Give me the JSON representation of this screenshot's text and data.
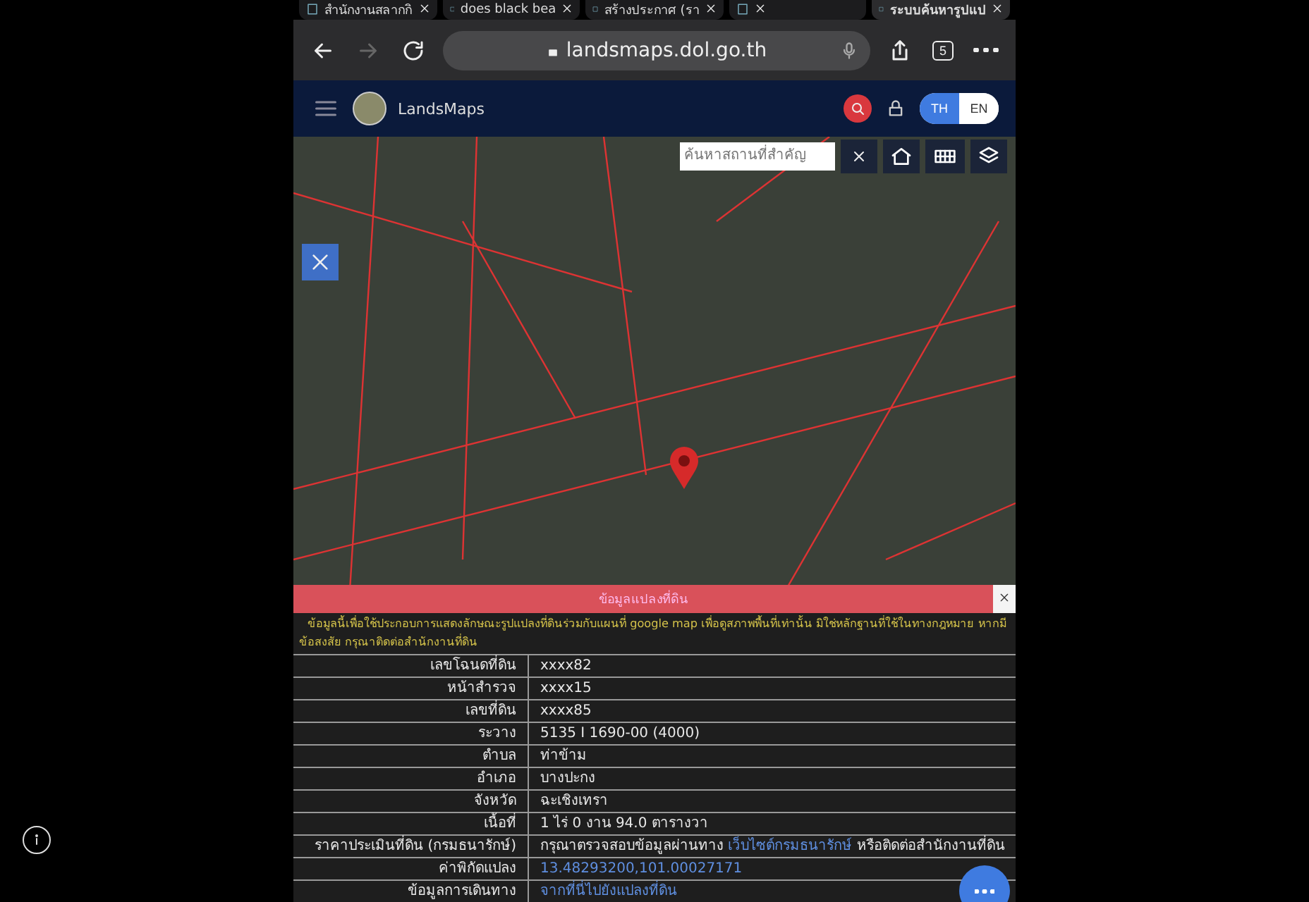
{
  "browser": {
    "tabs": [
      {
        "title": "สำนักงานสลากกิ",
        "selected": false
      },
      {
        "title": "does black bea",
        "selected": false
      },
      {
        "title": "สร้างประกาศ (รา",
        "selected": false
      },
      {
        "selected": false
      },
      {
        "title": "ระบบค้นหารูปแป",
        "selected": true
      }
    ],
    "url": "landsmaps.dol.go.th",
    "forward_disabled": true,
    "tab_count": "5"
  },
  "app": {
    "name": "LandsMaps",
    "languages": [
      {
        "label": "TH",
        "selected": true
      },
      {
        "label": "EN",
        "selected": false
      }
    ]
  },
  "map": {
    "search": {
      "placeholder": "ค้นหาสถานที่สำคัญ"
    }
  },
  "panel": {
    "title": "ข้อมูลแปลงที่ดิน",
    "notice": "ข้อมูลนี้เพื่อใช้ประกอบการแสดงลักษณะรูปแปลงที่ดินร่วมกับแผนที่ google map เพื่อดูสภาพพื้นที่เท่านั้น มิใช่หลักฐานที่ใช้ในทางกฎหมาย หากมีข้อสงสัย กรุณาติดต่อสำนักงานที่ดิน",
    "rows": [
      {
        "label": "เลขโฉนดที่ดิน",
        "kind": "text",
        "value": "xxxx82"
      },
      {
        "label": "หน้าสำรวจ",
        "kind": "text",
        "value": "xxxx15"
      },
      {
        "label": "เลขที่ดิน",
        "kind": "text",
        "value": "xxxx85"
      },
      {
        "label": "ระวาง",
        "kind": "text",
        "value": "5135 I 1690-00 (4000)"
      },
      {
        "label": "ตำบล",
        "kind": "text",
        "value": "ท่าข้าม"
      },
      {
        "label": "อำเภอ",
        "kind": "text",
        "value": "บางปะกง"
      },
      {
        "label": "จังหวัด",
        "kind": "text",
        "value": "ฉะเชิงเทรา"
      },
      {
        "label": "เนื้อที่",
        "kind": "text",
        "value": "1 ไร่ 0 งาน 94.0 ตารางวา"
      },
      {
        "label": "ราคาประเมินที่ดิน (กรมธนารักษ์)",
        "kind": "mixed",
        "value": "กรุณาตรวจสอบข้อมูลผ่านทาง",
        "link": "เว็บไซต์กรมธนารักษ์",
        "after": "หรือติดต่อสำนักงานที่ดิน"
      },
      {
        "label": "ค่าพิกัดแปลง",
        "kind": "link",
        "value": "13.48293200,101.00027171"
      },
      {
        "label": "ข้อมูลการเดินทาง",
        "kind": "link",
        "value": "จากที่นี่ไปยังแปลงที่ดิน"
      }
    ]
  }
}
